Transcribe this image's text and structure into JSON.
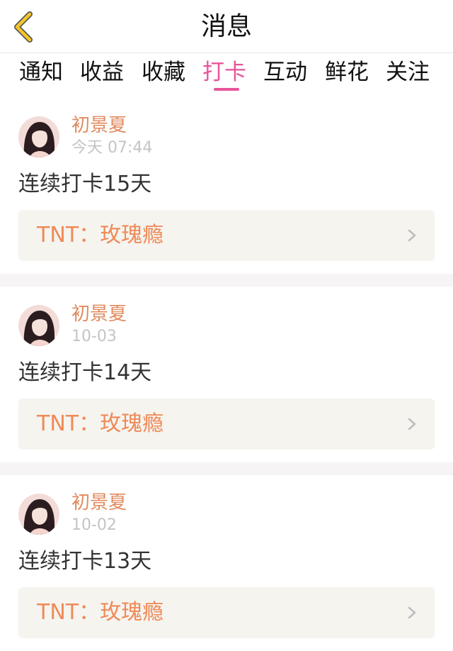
{
  "header": {
    "title": "消息"
  },
  "tabs": [
    {
      "label": "通知",
      "active": false
    },
    {
      "label": "收益",
      "active": false
    },
    {
      "label": "收藏",
      "active": false
    },
    {
      "label": "打卡",
      "active": true
    },
    {
      "label": "互动",
      "active": false
    },
    {
      "label": "鲜花",
      "active": false
    },
    {
      "label": "关注",
      "active": false
    }
  ],
  "messages": [
    {
      "user": "初景夏",
      "time": "今天 07:44",
      "text": "连续打卡15天",
      "link": "TNT：玫瑰瘾"
    },
    {
      "user": "初景夏",
      "time": "10-03",
      "text": "连续打卡14天",
      "link": "TNT：玫瑰瘾"
    },
    {
      "user": "初景夏",
      "time": "10-02",
      "text": "连续打卡13天",
      "link": "TNT：玫瑰瘾"
    }
  ],
  "colors": {
    "accent": "#e8549a",
    "username": "#e08a5e",
    "link_text": "#ef8a58",
    "back_icon": "#f3c528"
  },
  "icons": {
    "back": "chevron-left-icon",
    "row_chevron": "chevron-right-icon",
    "avatar": "avatar"
  }
}
